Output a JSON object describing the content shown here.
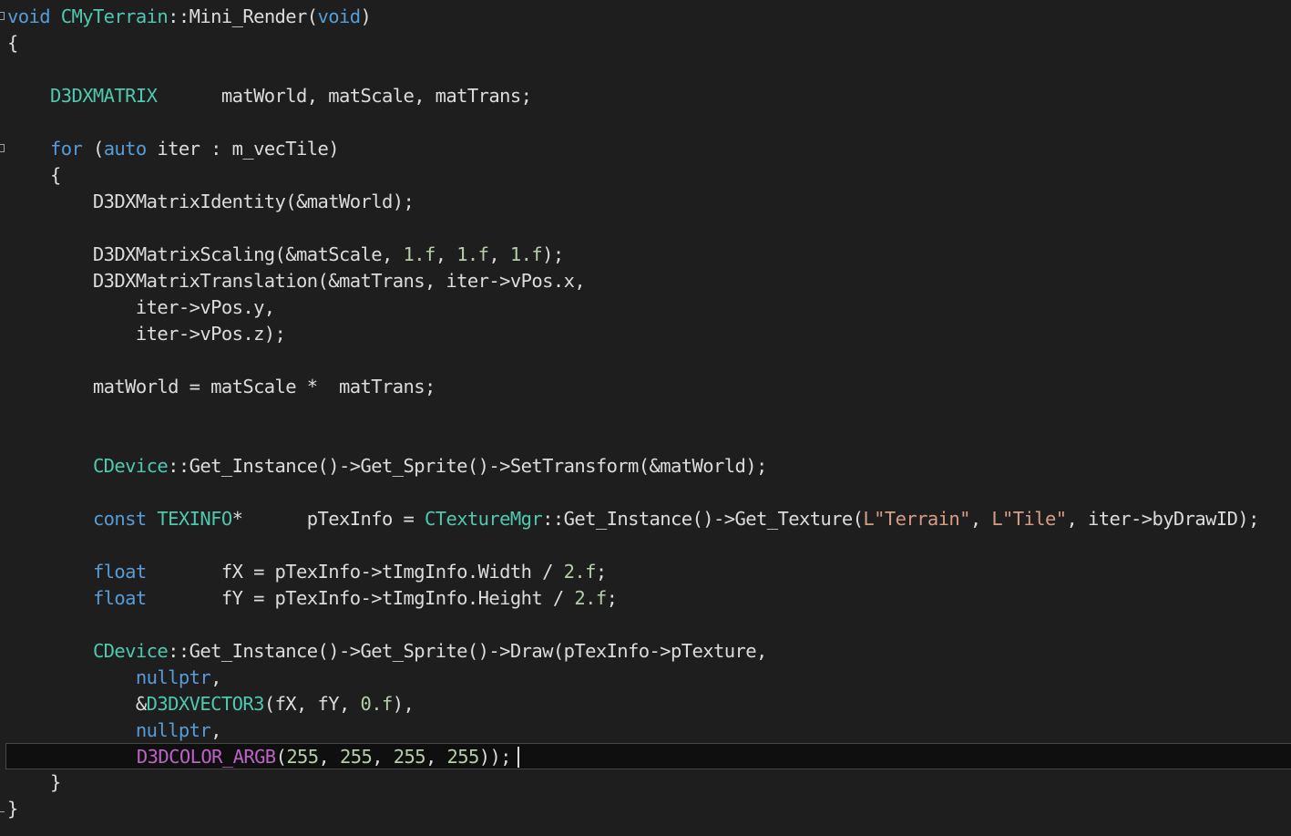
{
  "colors": {
    "background": "#1e1e1e",
    "plain": "#dcdcdc",
    "keyword": "#569cd6",
    "type": "#4ec9b0",
    "number": "#b5cea8",
    "string": "#d69d85",
    "macro": "#bd63c5",
    "current_line": "#0f0f0f"
  },
  "lines": [
    [
      {
        "t": "void",
        "c": "keyword"
      },
      {
        "t": " "
      },
      {
        "t": "CMyTerrain",
        "c": "type"
      },
      {
        "t": "::Mini_Render("
      },
      {
        "t": "void",
        "c": "keyword"
      },
      {
        "t": ")"
      }
    ],
    [
      {
        "t": "{"
      }
    ],
    [],
    [
      {
        "t": "    "
      },
      {
        "t": "D3DXMATRIX",
        "c": "type"
      },
      {
        "t": "      matWorld, matScale, matTrans;"
      }
    ],
    [],
    [
      {
        "t": "    "
      },
      {
        "t": "for",
        "c": "keyword"
      },
      {
        "t": " ("
      },
      {
        "t": "auto",
        "c": "keyword"
      },
      {
        "t": " iter : m_vecTile)"
      }
    ],
    [
      {
        "t": "    {"
      }
    ],
    [
      {
        "t": "        D3DXMatrixIdentity(&matWorld);"
      }
    ],
    [],
    [
      {
        "t": "        D3DXMatrixScaling(&matScale, "
      },
      {
        "t": "1.f",
        "c": "number"
      },
      {
        "t": ", "
      },
      {
        "t": "1.f",
        "c": "number"
      },
      {
        "t": ", "
      },
      {
        "t": "1.f",
        "c": "number"
      },
      {
        "t": ");"
      }
    ],
    [
      {
        "t": "        D3DXMatrixTranslation(&matTrans, iter->vPos.x,"
      }
    ],
    [
      {
        "t": "            iter->vPos.y,"
      }
    ],
    [
      {
        "t": "            iter->vPos.z);"
      }
    ],
    [],
    [
      {
        "t": "        matWorld = matScale *  matTrans;"
      }
    ],
    [],
    [],
    [
      {
        "t": "        "
      },
      {
        "t": "CDevice",
        "c": "type"
      },
      {
        "t": "::Get_Instance()->Get_Sprite()->SetTransform(&matWorld);"
      }
    ],
    [],
    [
      {
        "t": "        "
      },
      {
        "t": "const",
        "c": "keyword"
      },
      {
        "t": " "
      },
      {
        "t": "TEXINFO",
        "c": "type"
      },
      {
        "t": "*      pTexInfo = "
      },
      {
        "t": "CTextureMgr",
        "c": "type"
      },
      {
        "t": "::Get_Instance()->Get_Texture("
      },
      {
        "t": "L\"Terrain\"",
        "c": "string"
      },
      {
        "t": ", "
      },
      {
        "t": "L\"Tile\"",
        "c": "string"
      },
      {
        "t": ", iter->byDrawID);"
      }
    ],
    [],
    [
      {
        "t": "        "
      },
      {
        "t": "float",
        "c": "keyword"
      },
      {
        "t": "       fX = pTexInfo->tImgInfo.Width / "
      },
      {
        "t": "2.f",
        "c": "number"
      },
      {
        "t": ";"
      }
    ],
    [
      {
        "t": "        "
      },
      {
        "t": "float",
        "c": "keyword"
      },
      {
        "t": "       fY = pTexInfo->tImgInfo.Height / "
      },
      {
        "t": "2.f",
        "c": "number"
      },
      {
        "t": ";"
      }
    ],
    [],
    [
      {
        "t": "        "
      },
      {
        "t": "CDevice",
        "c": "type"
      },
      {
        "t": "::Get_Instance()->Get_Sprite()->Draw(pTexInfo->pTexture,"
      }
    ],
    [
      {
        "t": "            "
      },
      {
        "t": "nullptr",
        "c": "keyword"
      },
      {
        "t": ","
      }
    ],
    [
      {
        "t": "            &"
      },
      {
        "t": "D3DXVECTOR3",
        "c": "type"
      },
      {
        "t": "(fX, fY, "
      },
      {
        "t": "0.f",
        "c": "number"
      },
      {
        "t": "),"
      }
    ],
    [
      {
        "t": "            "
      },
      {
        "t": "nullptr",
        "c": "keyword"
      },
      {
        "t": ","
      }
    ],
    [
      {
        "t": "            "
      },
      {
        "t": "D3DCOLOR_ARGB",
        "c": "macro"
      },
      {
        "t": "("
      },
      {
        "t": "255",
        "c": "number"
      },
      {
        "t": ", "
      },
      {
        "t": "255",
        "c": "number"
      },
      {
        "t": ", "
      },
      {
        "t": "255",
        "c": "number"
      },
      {
        "t": ", "
      },
      {
        "t": "255",
        "c": "number"
      },
      {
        "t": "));"
      }
    ],
    [
      {
        "t": "    }"
      }
    ],
    [
      {
        "t": "}"
      }
    ]
  ]
}
